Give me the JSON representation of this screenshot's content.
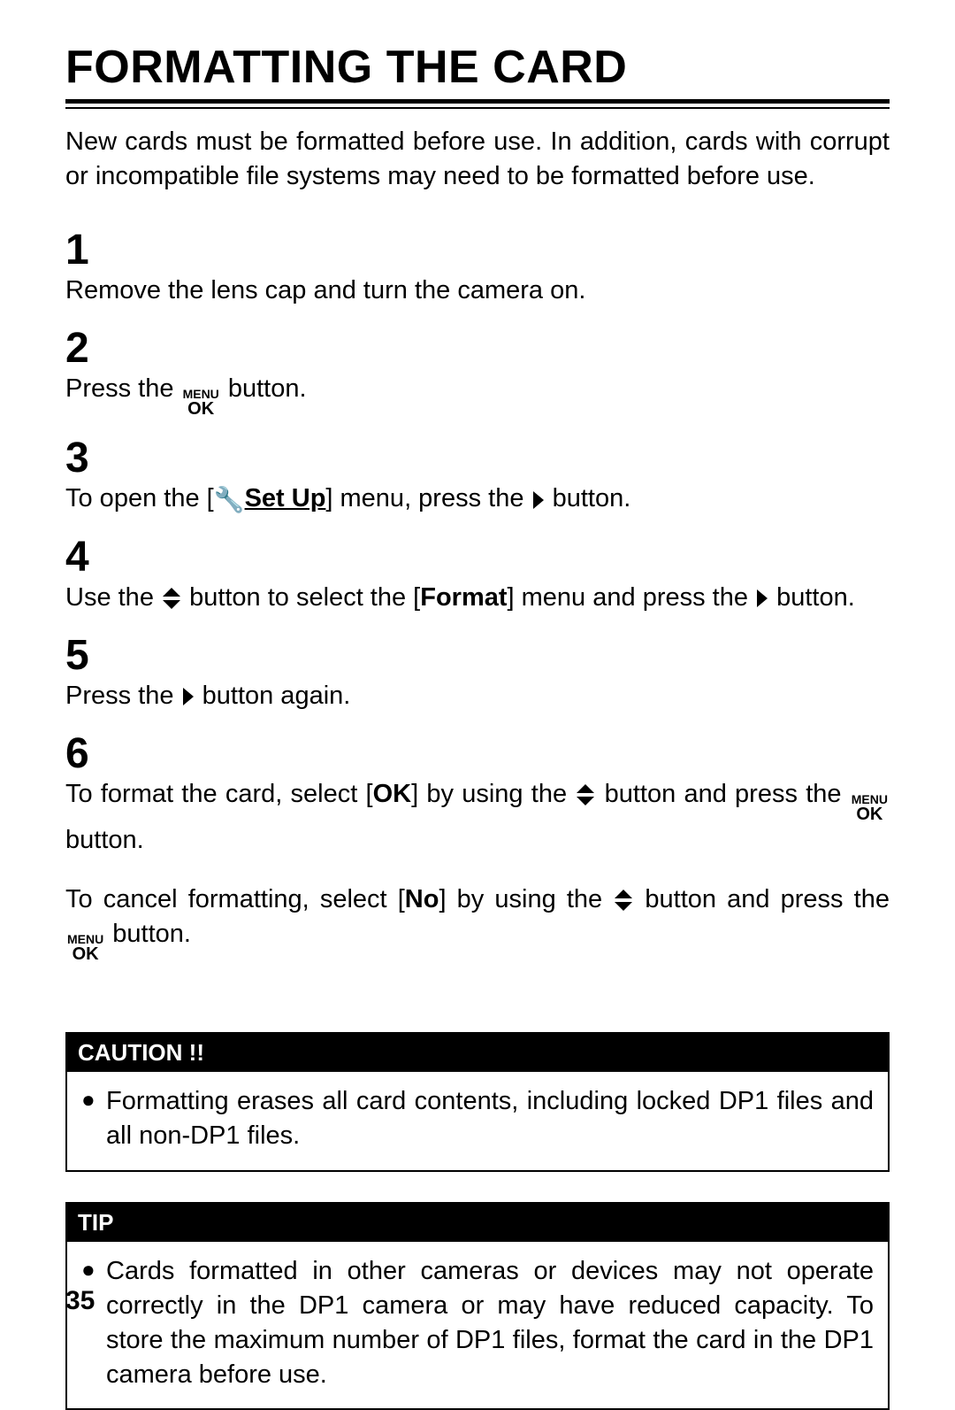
{
  "title": "FORMATTING THE CARD",
  "intro": "New cards must be formatted before use. In addition, cards with corrupt or incompatible file systems may need to be formatted before use.",
  "steps": {
    "n1": "1",
    "s1": "Remove the lens cap and turn the camera on.",
    "n2": "2",
    "s2_a": "Press the ",
    "s2_b": " button.",
    "n3": "3",
    "s3_a": "To open the [",
    "s3_setup": "Set Up",
    "s3_b": "] menu, press the ",
    "s3_c": " button.",
    "n4": "4",
    "s4_a": "Use the ",
    "s4_b": " button to select the [",
    "s4_format": "Format",
    "s4_c": "] menu and press the ",
    "s4_d": " button.",
    "n5": "5",
    "s5_a": "Press the ",
    "s5_b": " button again.",
    "n6": "6",
    "s6_a": "To format the card, select [",
    "s6_ok": "OK",
    "s6_b": "] by using the ",
    "s6_c": " button and press the ",
    "s6_d": "button.",
    "s6_e": "To cancel formatting, select [",
    "s6_no": "No",
    "s6_f": "] by using the ",
    "s6_g": " button and press the ",
    "s6_h": " button."
  },
  "menu_icon": {
    "top": "MENU",
    "bottom": "OK"
  },
  "caution": {
    "header": "CAUTION !!",
    "bullet": "Formatting erases all card contents, including locked DP1 files and all non-DP1 files."
  },
  "tip": {
    "header": "TIP",
    "bullet": "Cards formatted in other cameras or devices may not operate correctly in the DP1 camera or may have reduced capacity. To store the maximum number of DP1 files, format the card in the DP1 camera before use."
  },
  "page_number": "35"
}
